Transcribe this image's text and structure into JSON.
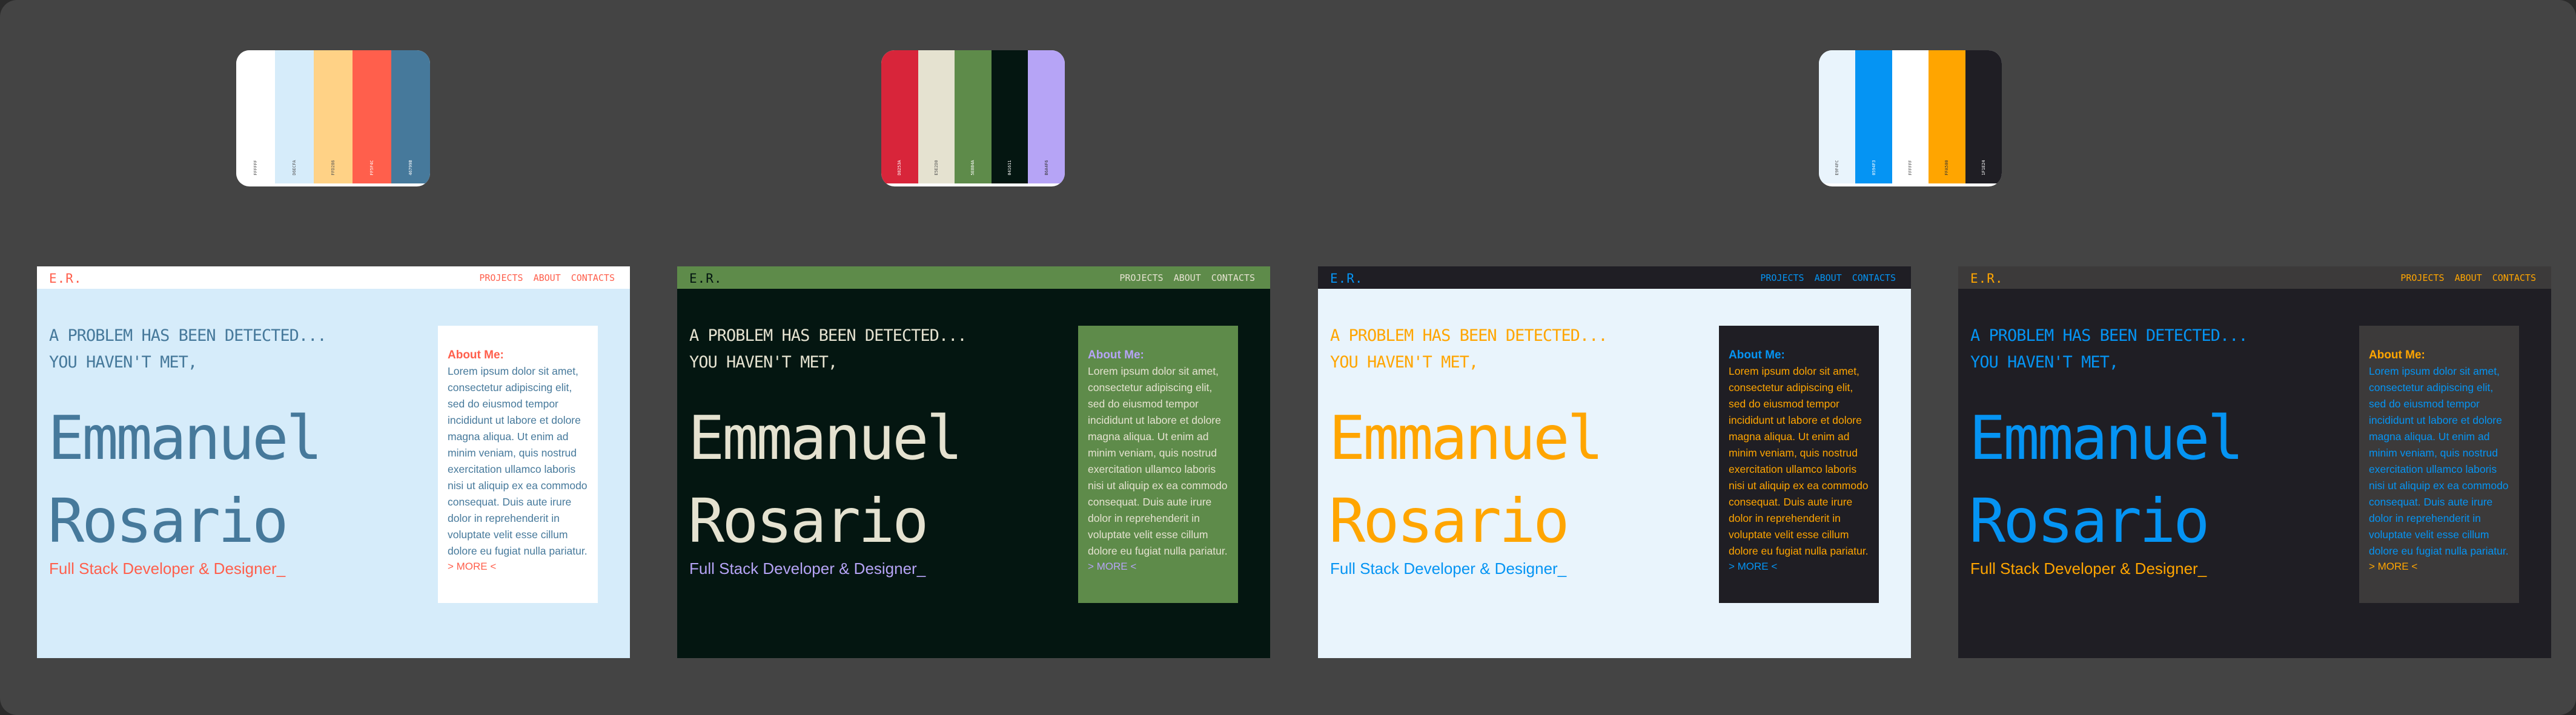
{
  "palettes": [
    {
      "id": "p1",
      "swatches": [
        {
          "color": "#ffffff",
          "label": "FFFFFF",
          "text": "#555555"
        },
        {
          "color": "#d6ecfa",
          "label": "D6ECFA",
          "text": "#555555"
        },
        {
          "color": "#ffd286",
          "label": "FFD286",
          "text": "#555555"
        },
        {
          "color": "#ff5f4c",
          "label": "FF5F4C",
          "text": "#ffffff"
        },
        {
          "color": "#46799b",
          "label": "46799B",
          "text": "#ffffff"
        }
      ]
    },
    {
      "id": "p2",
      "swatches": [
        {
          "color": "#d8253a",
          "label": "D8253A",
          "text": "#ffffff"
        },
        {
          "color": "#e5e2d0",
          "label": "E5E2D0",
          "text": "#555555"
        },
        {
          "color": "#5e8b4a",
          "label": "5E8B4A",
          "text": "#ffffff"
        },
        {
          "color": "#041611",
          "label": "041611",
          "text": "#ffffff"
        },
        {
          "color": "#b6a4f6",
          "label": "B6A4F6",
          "text": "#333333"
        }
      ]
    },
    {
      "id": "p3",
      "swatches": [
        {
          "color": "#e9f4fc",
          "label": "E9F4FC",
          "text": "#555555"
        },
        {
          "color": "#0594f3",
          "label": "0594F3",
          "text": "#ffffff"
        },
        {
          "color": "#ffffff",
          "label": "FFFFFF",
          "text": "#555555"
        },
        {
          "color": "#ffa500",
          "label": "FFA500",
          "text": "#333333"
        },
        {
          "color": "#1f1e24",
          "label": "1F1E24",
          "text": "#ffffff"
        }
      ]
    }
  ],
  "site": {
    "logo": "E.R.",
    "nav": [
      "PROJECTS",
      "ABOUT",
      "CONTACTS"
    ],
    "headline1": "A PROBLEM HAS BEEN DETECTED...",
    "headline2": "YOU HAVEN'T MET,",
    "first_name": "Emmanuel",
    "last_name": "Rosario",
    "role": "Full Stack Developer & Designer_",
    "about_title": "About Me:",
    "about_body": "Lorem ipsum dolor sit amet, consectetur adipiscing elit, sed do eiusmod tempor incididunt ut labore et dolore magna aliqua. Ut enim ad minim veniam, quis nostrud exercitation ullamco laboris nisi ut aliquip ex ea commodo consequat. Duis aute irure dolor in reprehenderit in voluptate velit esse cillum dolore eu fugiat nulla pariatur.",
    "more": "> MORE <"
  },
  "themes": [
    {
      "id": "light-blue",
      "bg": "#d6ecfa",
      "nav_bg": "#ffffff",
      "logo": "#ff5f4c",
      "links": "#ff5f4c",
      "headline": "#46799b",
      "name": "#46799b",
      "role": "#ff5f4c",
      "card_bg": "#ffffff",
      "card_title": "#ff5f4c",
      "card_text": "#46799b",
      "more": "#ff5f4c"
    },
    {
      "id": "dark-green",
      "bg": "#041611",
      "nav_bg": "#5e8b4a",
      "logo": "#041611",
      "links": "#e5e2d0",
      "headline": "#e5e2d0",
      "name": "#e5e2d0",
      "role": "#b6a4f6",
      "card_bg": "#5e8b4a",
      "card_title": "#b6a4f6",
      "card_text": "#e5e2d0",
      "more": "#b6a4f6"
    },
    {
      "id": "light-orange",
      "bg": "#e9f4fc",
      "nav_bg": "#1f1e24",
      "logo": "#0594f3",
      "links": "#0594f3",
      "headline": "#ffa500",
      "name": "#ffa500",
      "role": "#0594f3",
      "card_bg": "#1f1e24",
      "card_title": "#0594f3",
      "card_text": "#ffa500",
      "more": "#0594f3"
    },
    {
      "id": "dark-blue",
      "bg": "#1f1e24",
      "nav_bg": "#3c3a3a",
      "logo": "#ffa500",
      "links": "#ffa500",
      "headline": "#0594f3",
      "name": "#0594f3",
      "role": "#ffa500",
      "card_bg": "#3c3a3a",
      "card_title": "#ffa500",
      "card_text": "#0594f3",
      "more": "#ffa500"
    }
  ]
}
